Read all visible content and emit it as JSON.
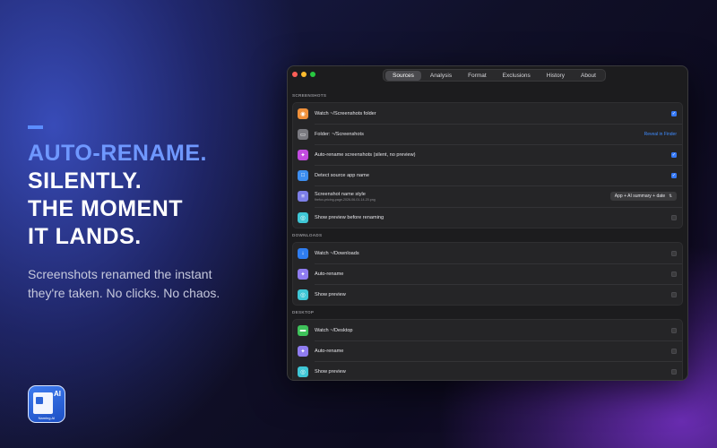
{
  "hero": {
    "lines": [
      "AUTO-RENAME.",
      "SILENTLY.",
      "THE MOMENT",
      "IT LANDS."
    ],
    "subtext_1": "Screenshots renamed the instant",
    "subtext_2": "they're taken. No clicks. No chaos."
  },
  "app_icon": {
    "badge": "AI",
    "caption": "Naming.AI"
  },
  "tabs": [
    "Sources",
    "Analysis",
    "Format",
    "Exclusions",
    "History",
    "About"
  ],
  "active_tab": "Sources",
  "sections": [
    {
      "label": "SCREENSHOTS",
      "rows": [
        {
          "label": "Watch ~/Screenshots folder",
          "icon": "camera-icon",
          "color": "#f0903a",
          "control": "check",
          "checked": true
        },
        {
          "label": "Folder: ~/Screenshots",
          "icon": "folder-icon",
          "color": "#7a7a80",
          "control": "link",
          "link": "Reveal in Finder"
        },
        {
          "label": "Auto-rename screenshots (silent, no preview)",
          "icon": "sparkle-icon",
          "color": "#c24be0",
          "control": "check",
          "checked": true
        },
        {
          "label": "Detect source app name",
          "icon": "window-icon",
          "color": "#3d8ef0",
          "control": "check",
          "checked": true
        },
        {
          "label": "Screenshot name style",
          "sub": "firefox-pricing-page-2026-06-01-14-20.png",
          "icon": "list-icon",
          "color": "#7d7fe8",
          "control": "select",
          "value": "App + AI summary + date"
        },
        {
          "label": "Show preview before renaming",
          "icon": "eye-icon",
          "color": "#3fc7d6",
          "control": "check",
          "checked": false
        }
      ]
    },
    {
      "label": "DOWNLOADS",
      "rows": [
        {
          "label": "Watch ~/Downloads",
          "icon": "download-icon",
          "color": "#2f7df0",
          "control": "check",
          "checked": false
        },
        {
          "label": "Auto-rename",
          "icon": "sparkle-icon",
          "color": "#8f7cf0",
          "control": "check",
          "checked": false
        },
        {
          "label": "Show preview",
          "icon": "eye-icon",
          "color": "#3fc7d6",
          "control": "check",
          "checked": false
        }
      ]
    },
    {
      "label": "DESKTOP",
      "rows": [
        {
          "label": "Watch ~/Desktop",
          "icon": "desktop-icon",
          "color": "#3ec25a",
          "control": "check",
          "checked": false
        },
        {
          "label": "Auto-rename",
          "icon": "sparkle-icon",
          "color": "#8f7cf0",
          "control": "check",
          "checked": false
        },
        {
          "label": "Show preview",
          "icon": "eye-icon",
          "color": "#3fc7d6",
          "control": "check",
          "checked": false
        }
      ]
    }
  ]
}
